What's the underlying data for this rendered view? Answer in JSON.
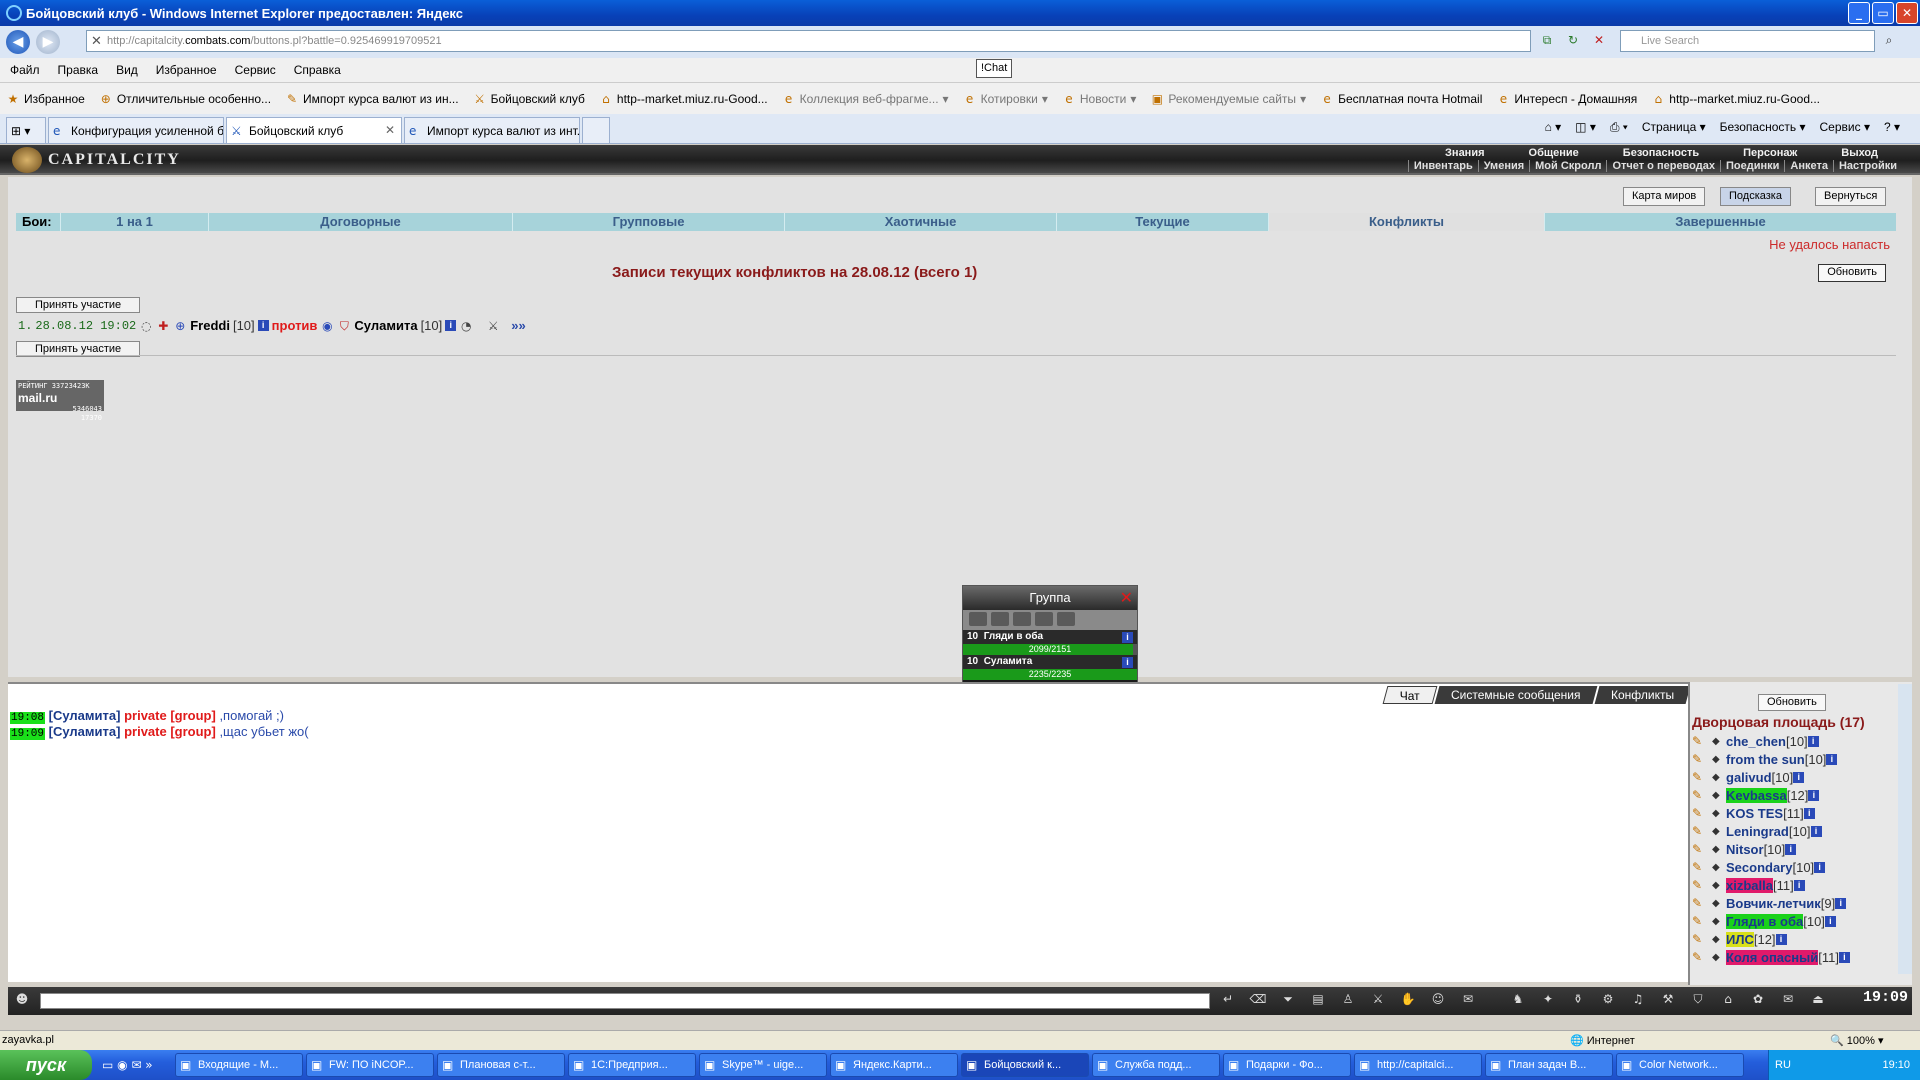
{
  "window": {
    "title": "Бойцовский клуб - Windows Internet Explorer предоставлен: Яндекс"
  },
  "address": {
    "url_prefix": "http://capitalcity.",
    "url_domain": "combats.com",
    "url_rest": "/buttons.pl?battle=0.925469919709521",
    "search_placeholder": "Live Search"
  },
  "menu": [
    "Файл",
    "Правка",
    "Вид",
    "Избранное",
    "Сервис",
    "Справка"
  ],
  "chat_widget": "!Chat",
  "favorites": {
    "label": "Избранное",
    "items": [
      {
        "label": "Отличительные особенно...",
        "dim": false
      },
      {
        "label": "Импорт курса валют из ин...",
        "dim": false
      },
      {
        "label": "Бойцовский клуб",
        "dim": false
      },
      {
        "label": "http--market.miuz.ru-Good...",
        "dim": false
      },
      {
        "label": "Коллекция веб-фрагме...",
        "dim": true
      },
      {
        "label": "Котировки",
        "dim": true
      },
      {
        "label": "Новости",
        "dim": true
      },
      {
        "label": "Рекомендуемые сайты",
        "dim": true
      },
      {
        "label": "Бесплатная почта Hotmail",
        "dim": false
      },
      {
        "label": "Интересп - Домашняя",
        "dim": false
      },
      {
        "label": "http--market.miuz.ru-Good...",
        "dim": false
      }
    ]
  },
  "tabs": [
    {
      "label": "Конфигурация усиленной б...",
      "active": false
    },
    {
      "label": "Бойцовский клуб",
      "active": true
    },
    {
      "label": "Импорт курса валют из инт...",
      "active": false
    }
  ],
  "command_bar": [
    "Страница ▾",
    "Безопасность ▾",
    "Сервис ▾"
  ],
  "game": {
    "logo": "CAPITALCITY",
    "top_nav": [
      "Знания",
      "Общение",
      "Безопасность",
      "Персонаж",
      "Выход"
    ],
    "sub_nav": [
      "Инвентарь",
      "Умения",
      "Мой Скролл",
      "Отчет о переводах",
      "Поединки",
      "Анкета",
      "Настройки"
    ],
    "buttons": {
      "map": "Карта миров",
      "hint": "Подсказка",
      "back": "Вернуться"
    },
    "battles_label": "Бои:",
    "battle_tabs": [
      {
        "label": "1 на 1",
        "selected": false
      },
      {
        "label": "Договорные",
        "selected": false
      },
      {
        "label": "Групповые",
        "selected": false
      },
      {
        "label": "Хаотичные",
        "selected": false
      },
      {
        "label": "Текущие",
        "selected": false
      },
      {
        "label": "Конфликты",
        "selected": true
      },
      {
        "label": "Завершенные",
        "selected": false
      }
    ],
    "error": "Не удалось напасть",
    "heading": "Записи текущих конфликтов на 28.08.12 (всего 1)",
    "refresh": "Обновить",
    "join": "Принять участие",
    "conflict": {
      "num": "1.",
      "datetime": "28.08.12 19:02",
      "player1": "Freddi",
      "level1": "[10]",
      "versus": "против",
      "player2": "Суламита",
      "level2": "[10]",
      "more": "»»"
    },
    "counter": {
      "line1": "РЕЙТИНГ 33723423K",
      "mail": "mail.ru",
      "line2": "5346043",
      "line3": "17370"
    }
  },
  "group_popup": {
    "title": "Группа",
    "members": [
      {
        "level": "10",
        "name": "Гляди в оба",
        "hp": "2099/2151",
        "hp_ratio": 0.976
      },
      {
        "level": "10",
        "name": "Суламита",
        "hp": "2235/2235",
        "hp_ratio": 1.0
      }
    ]
  },
  "chat": {
    "tabs": [
      {
        "label": "Чат",
        "selected": true
      },
      {
        "label": "Системные сообщения",
        "selected": false
      },
      {
        "label": "Конфликты",
        "selected": false
      }
    ],
    "messages": [
      {
        "time": "19:08",
        "who": "[Суламита]",
        "priv": "private [group]",
        "text": ",помогай ;)"
      },
      {
        "time": "19:09",
        "who": "[Суламита]",
        "priv": "private [group]",
        "text": ",щас убьет жо("
      }
    ]
  },
  "online": {
    "refresh": "Обновить",
    "title": "Дворцовая площадь (17)",
    "users": [
      {
        "name": "che_chen",
        "level": "[10]",
        "hl": ""
      },
      {
        "name": "from the sun",
        "level": "[10]",
        "hl": ""
      },
      {
        "name": "galivud",
        "level": "[10]",
        "hl": ""
      },
      {
        "name": "Kevbassa",
        "level": "[12]",
        "hl": "green"
      },
      {
        "name": "KOS TES",
        "level": "[11]",
        "hl": ""
      },
      {
        "name": "Leningrad",
        "level": "[10]",
        "hl": ""
      },
      {
        "name": "Nitsor",
        "level": "[10]",
        "hl": ""
      },
      {
        "name": "Secondary",
        "level": "[10]",
        "hl": ""
      },
      {
        "name": "xizballa",
        "level": "[11]",
        "hl": "red"
      },
      {
        "name": "Вовчик-летчик",
        "level": "[9]",
        "hl": ""
      },
      {
        "name": "Гляди в оба",
        "level": "[10]",
        "hl": "green"
      },
      {
        "name": "ИЛС",
        "level": "[12]",
        "hl": "yellow"
      },
      {
        "name": "Коля опасный",
        "level": "[11]",
        "hl": "red"
      }
    ]
  },
  "clock": "19:09",
  "status": {
    "left": "zayavka.pl",
    "zone": "Интернет",
    "zoom": "100%"
  },
  "taskbar": {
    "start": "пуск",
    "tasks": [
      {
        "label": "Входящие - М...",
        "active": false
      },
      {
        "label": "FW: ПО iNCOP...",
        "active": false
      },
      {
        "label": "Плановая с-т...",
        "active": false
      },
      {
        "label": "1С:Предприя...",
        "active": false
      },
      {
        "label": "Skype™ - uige...",
        "active": false
      },
      {
        "label": "Яндекс.Карти...",
        "active": false
      },
      {
        "label": "Бойцовский к...",
        "active": true
      },
      {
        "label": "Служба подд...",
        "active": false
      },
      {
        "label": "Подарки - Фо...",
        "active": false
      },
      {
        "label": "http://capitalci...",
        "active": false
      },
      {
        "label": "План задач B...",
        "active": false
      },
      {
        "label": "Color Network...",
        "active": false
      }
    ],
    "lang": "RU",
    "time": "19:10"
  }
}
